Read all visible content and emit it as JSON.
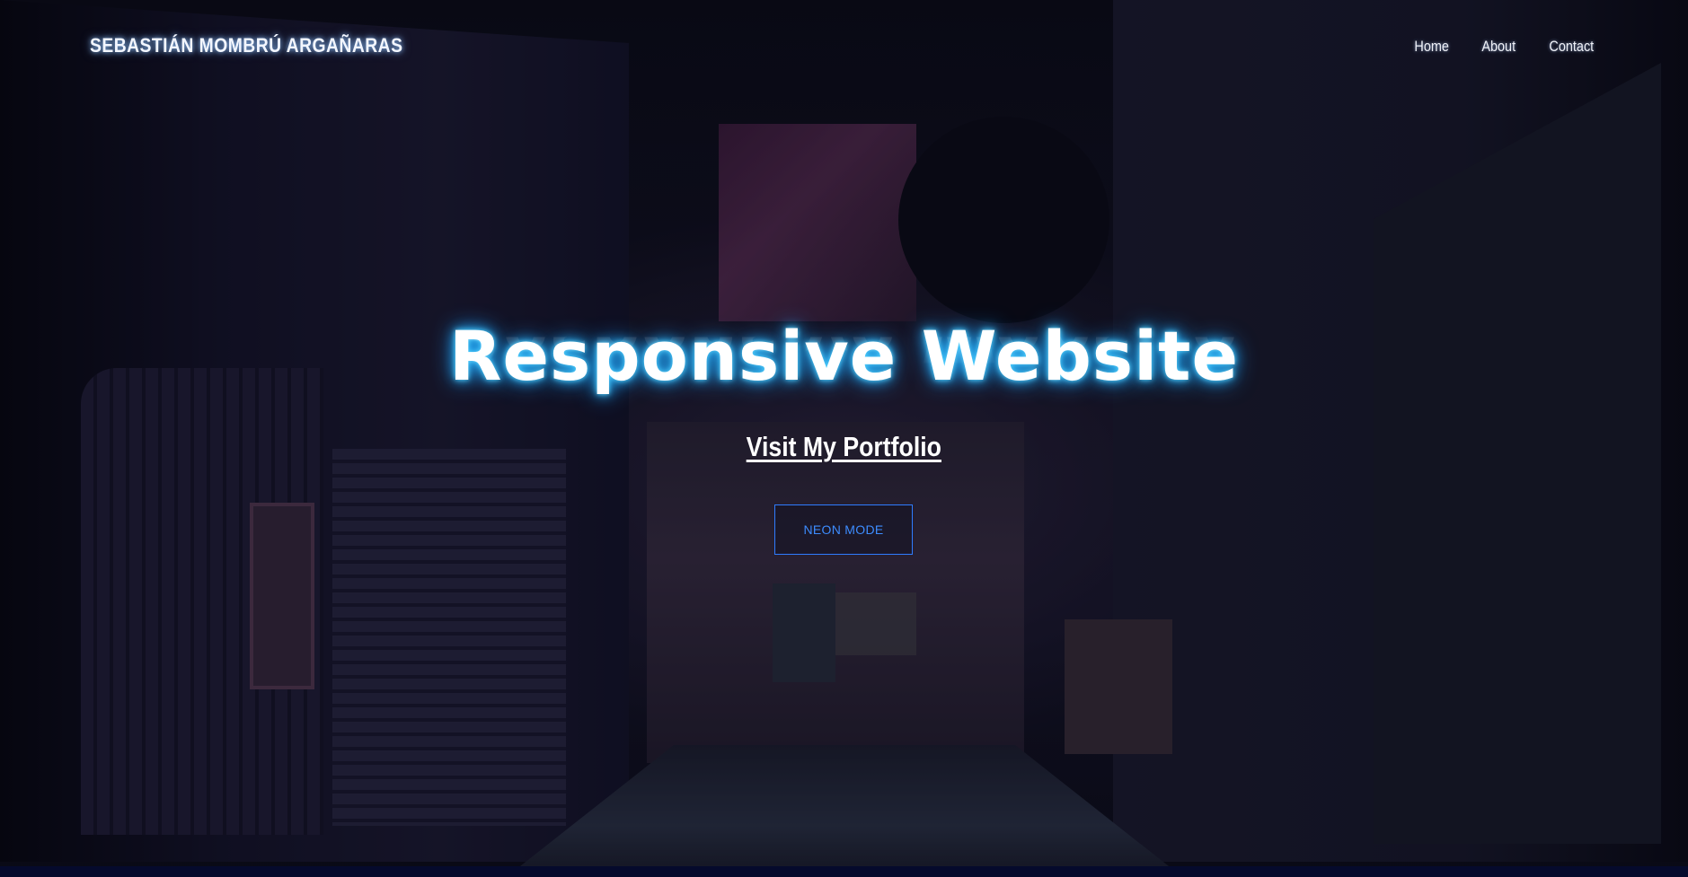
{
  "header": {
    "brand": "SEBASTIÁN MOMBRÚ ARGAÑARAS",
    "nav": [
      {
        "label": "Home"
      },
      {
        "label": "About"
      },
      {
        "label": "Contact"
      }
    ]
  },
  "hero": {
    "title": "Responsive Website",
    "portfolio_link": "Visit My Portfolio",
    "neon_button": "NEON MODE"
  },
  "colors": {
    "neon_glow": "#27b6ff",
    "button_accent": "#2f7cff",
    "background": "#05060d"
  }
}
